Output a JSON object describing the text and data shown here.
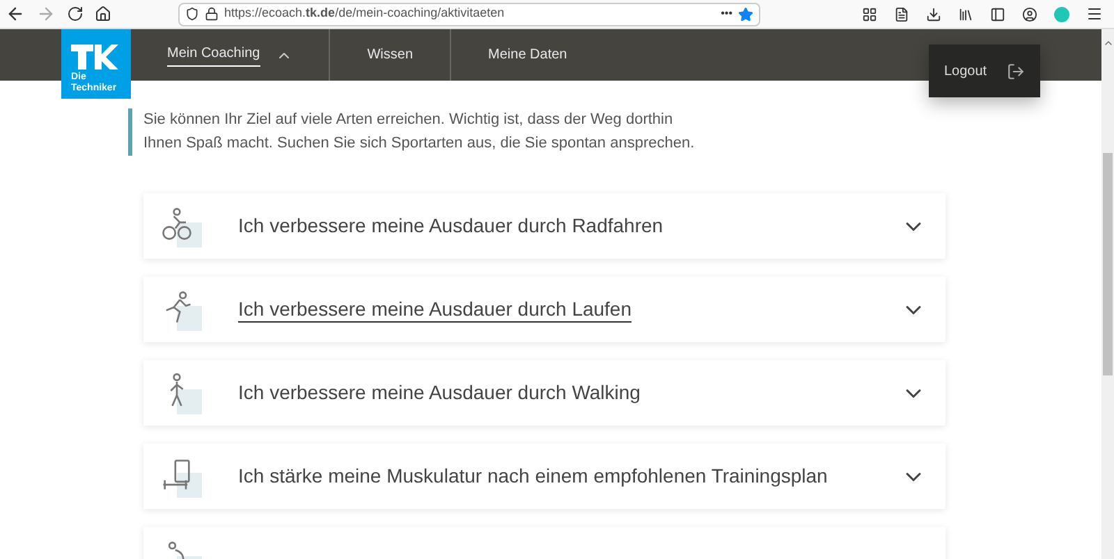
{
  "browser": {
    "url": "https://ecoach.**tk.de**/de/mein-coaching/aktivitaeten",
    "more": "•••"
  },
  "logo": {
    "line_1": "Die",
    "line_2": "Techniker"
  },
  "nav": [
    {
      "label": "Mein Coaching",
      "selected": true,
      "expanded": true
    },
    {
      "label": "Wissen",
      "selected": false,
      "expanded": false
    },
    {
      "label": "Meine Daten",
      "selected": false,
      "expanded": false
    }
  ],
  "logout": {
    "label": "Logout"
  },
  "intro": "Sie können Ihr Ziel auf viele Arten erreichen. Wichtig ist, dass der Weg dorthin Ihnen Spaß macht. Suchen Sie sich Sportarten aus, die Sie spontan ansprechen.",
  "activities": [
    {
      "kind": "cycling",
      "title": "Ich verbessere meine Ausdauer durch Radfahren",
      "hovered": false,
      "expanded": false
    },
    {
      "kind": "running",
      "title": "Ich verbessere meine Ausdauer durch Laufen",
      "hovered": true,
      "expanded": false
    },
    {
      "kind": "walking",
      "title": "Ich verbessere meine Ausdauer durch Walking",
      "hovered": false,
      "expanded": false
    },
    {
      "kind": "strength",
      "title": "Ich stärke meine Muskulatur nach einem empfohlenen Trainingsplan",
      "hovered": false,
      "expanded": false
    },
    {
      "kind": "stretching"
    }
  ]
}
